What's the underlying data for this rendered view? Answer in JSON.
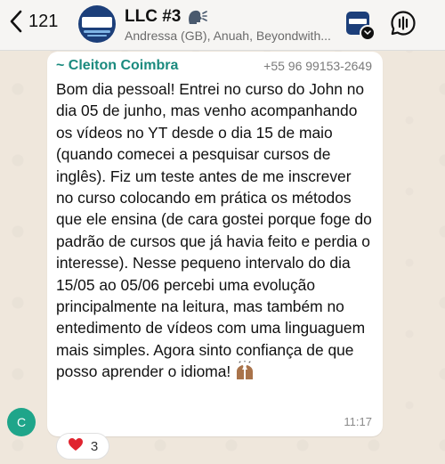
{
  "header": {
    "back_count": "121",
    "group_name": "LLC #3",
    "members": "Andressa (GB), Anuah, Beyondwith...",
    "avatar_icon": "language-logo-icon",
    "thumbnail_icon": "language-logo-icon"
  },
  "message": {
    "sender_name": "~ Cleiton Coimbra",
    "sender_phone": "+55 96 99153-2649",
    "text": "Bom dia pessoal! Entrei no curso do John no dia 05 de junho, mas venho acompanhando os vídeos no YT desde o dia 15 de maio (quando comecei a pesquisar cursos de inglês). Fiz um teste antes de me inscrever no curso colocando em prática os métodos que ele ensina (de cara gostei porque foge do padrão de cursos que já havia feito e perdia o interesse). Nesse pequeno intervalo do dia 15/05 ao 05/06 percebi uma evolução principalmente na leitura, mas também no entedimento de vídeos com uma linguaguem mais simples. Agora sinto confiança de que posso aprender o idioma!",
    "time": "11:17",
    "avatar_letter": "C",
    "emoji_icon": "raising-hands-icon"
  },
  "reaction": {
    "emoji": "❤️",
    "count": "3"
  },
  "colors": {
    "sender_name": "#1a8a7e",
    "avatar": "#1fa58a",
    "background": "#efe7dc"
  }
}
